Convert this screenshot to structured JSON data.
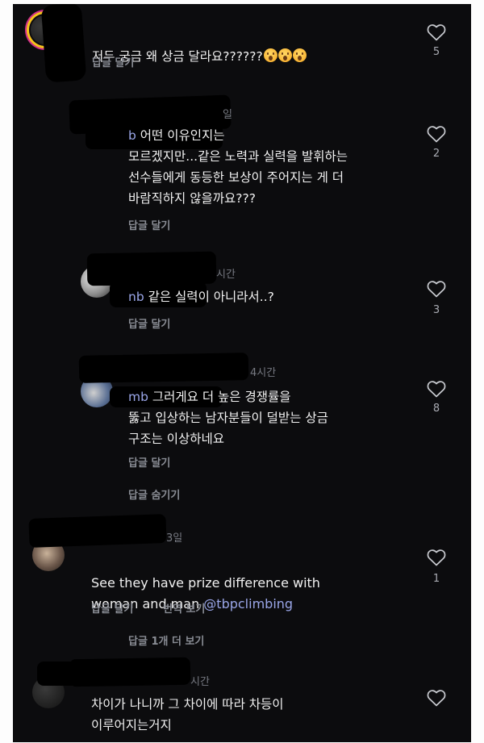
{
  "comments": [
    {
      "text": "저두 궁금 왜 상금 달라요??????",
      "reply": "답글 달기",
      "likes": "5"
    },
    {
      "time": "일",
      "mention_fragment": "b",
      "text": " 어떤 이유인지는\n모르겠지만...같은 노력과 실력을 발휘하는\n선수들에게 동등한 보상이 주어지는 게 더\n바람직하지 않을까요???",
      "reply": "답글 달기",
      "likes": "2"
    },
    {
      "time": "시간",
      "mention_fragment": "nb",
      "text": " 같은 실력이 아니라서..?",
      "reply": "답글 달기",
      "likes": "3"
    },
    {
      "time": "4시간",
      "mention_fragment": "mb",
      "text": " 그러게요 더 높은 경쟁률을\n뚫고 입상하는 남자분들이 덜받는 상금\n구조는 이상하네요",
      "reply": "답글 달기",
      "hide": "답글 숨기기",
      "likes": "8"
    },
    {
      "time": "3일",
      "text_line1": "See they have prize difference with",
      "text_line2_prefix": "woman and man ",
      "mention": "@tbpclimbing",
      "reply": "답글 달기",
      "translate": "번역 보기",
      "more": "답글 1개 더 보기",
      "likes": "1"
    },
    {
      "time": "시간",
      "text": "차이가 나니까 그 차이에 따라 차등이\n이루어지는거지"
    }
  ],
  "colors": {
    "background": "#0c0c0e",
    "text": "#f1f1f1",
    "secondary": "#8a8d95",
    "mention": "#9aa6e8"
  },
  "icons": {
    "like": "heart-outline-icon",
    "reaction": "astonished-face-emoji"
  }
}
